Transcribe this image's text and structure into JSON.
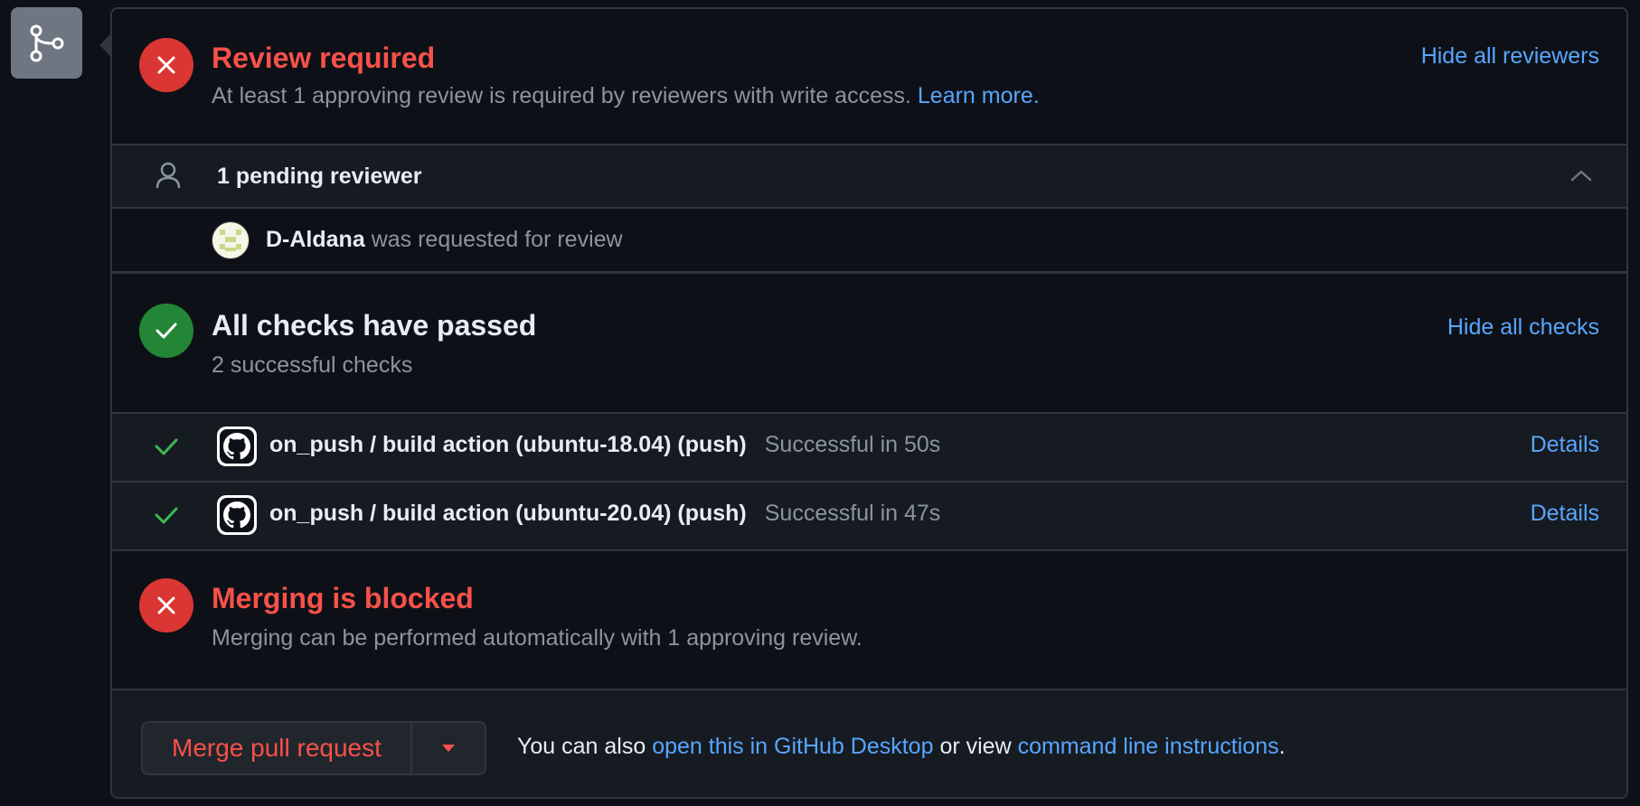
{
  "review": {
    "title": "Review required",
    "description": "At least 1 approving review is required by reviewers with write access.",
    "learn_more": "Learn more.",
    "hide_reviewers": "Hide all reviewers"
  },
  "reviewers": {
    "summary": "1 pending reviewer",
    "items": [
      {
        "name": "D-Aldana",
        "status": "was requested for review"
      }
    ]
  },
  "checks": {
    "title": "All checks have passed",
    "subtitle": "2 successful checks",
    "hide_checks": "Hide all checks",
    "items": [
      {
        "name": "on_push / build action (ubuntu-18.04) (push)",
        "status": "Successful in 50s",
        "details": "Details"
      },
      {
        "name": "on_push / build action (ubuntu-20.04) (push)",
        "status": "Successful in 47s",
        "details": "Details"
      }
    ]
  },
  "merging": {
    "title": "Merging is blocked",
    "description": "Merging can be performed automatically with 1 approving review."
  },
  "merge_box": {
    "button_label": "Merge pull request",
    "hint_prefix": "You can also",
    "desktop_link": "open this in GitHub Desktop",
    "hint_middle": "or view",
    "cli_link": "command line instructions",
    "hint_suffix": "."
  },
  "colors": {
    "background": "#0d1117",
    "error": "#f85149",
    "success": "#238636",
    "link": "#58a6ff",
    "border": "#30363d"
  }
}
